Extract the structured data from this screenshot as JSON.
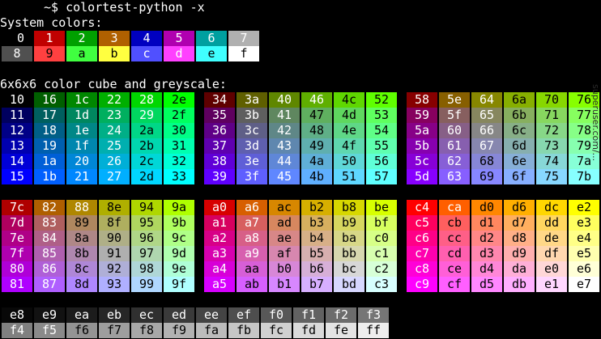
{
  "terminal": {
    "prompt_line": "~$ colortest-python -x",
    "system_header": "System colors:",
    "cube_header": "6x6x6 color cube and greyscale:",
    "watermark": "superuser.com/..."
  },
  "system_colors": {
    "row1": [
      {
        "label": " 0",
        "bg": "#000000",
        "fg": "#ffffff"
      },
      {
        "label": "1",
        "bg": "#c00000",
        "fg": "#ffffff"
      },
      {
        "label": "2",
        "bg": "#00a000",
        "fg": "#ffffff"
      },
      {
        "label": "3",
        "bg": "#b06000",
        "fg": "#ffffff"
      },
      {
        "label": "4",
        "bg": "#0000c0",
        "fg": "#ffffff"
      },
      {
        "label": "5",
        "bg": "#b000b0",
        "fg": "#ffffff"
      },
      {
        "label": "6",
        "bg": "#00a0a0",
        "fg": "#ffffff"
      },
      {
        "label": "7",
        "bg": "#b0b0b0",
        "fg": "#ffffff"
      }
    ],
    "row2": [
      {
        "label": "8",
        "bg": "#505050",
        "fg": "#ffffff"
      },
      {
        "label": "9",
        "bg": "#ff4040",
        "fg": "#000000"
      },
      {
        "label": "a",
        "bg": "#40ff40",
        "fg": "#000000"
      },
      {
        "label": "b",
        "bg": "#ffff40",
        "fg": "#000000"
      },
      {
        "label": "c",
        "bg": "#5050ff",
        "fg": "#ffffff"
      },
      {
        "label": "d",
        "bg": "#ff40ff",
        "fg": "#ffffff"
      },
      {
        "label": "e",
        "bg": "#40ffff",
        "fg": "#000000"
      },
      {
        "label": "f",
        "bg": "#ffffff",
        "fg": "#000000"
      }
    ]
  },
  "cube_blocks": [
    {
      "rows": [
        [
          "10",
          "16",
          "1c",
          "22",
          "28",
          "2e"
        ],
        [
          "11",
          "17",
          "1d",
          "23",
          "29",
          "2f"
        ],
        [
          "12",
          "18",
          "1e",
          "24",
          "2a",
          "30"
        ],
        [
          "13",
          "19",
          "1f",
          "25",
          "2b",
          "31"
        ],
        [
          "14",
          "1a",
          "20",
          "26",
          "2c",
          "32"
        ],
        [
          "15",
          "1b",
          "21",
          "27",
          "2d",
          "33"
        ]
      ]
    },
    {
      "rows": [
        [
          "34",
          "3a",
          "40",
          "46",
          "4c",
          "52"
        ],
        [
          "35",
          "3b",
          "41",
          "47",
          "4d",
          "53"
        ],
        [
          "36",
          "3c",
          "42",
          "48",
          "4e",
          "54"
        ],
        [
          "37",
          "3d",
          "43",
          "49",
          "4f",
          "55"
        ],
        [
          "38",
          "3e",
          "44",
          "4a",
          "50",
          "56"
        ],
        [
          "39",
          "3f",
          "45",
          "4b",
          "51",
          "57"
        ]
      ]
    },
    {
      "rows": [
        [
          "58",
          "5e",
          "64",
          "6a",
          "70",
          "76"
        ],
        [
          "59",
          "5f",
          "65",
          "6b",
          "71",
          "77"
        ],
        [
          "5a",
          "60",
          "66",
          "6c",
          "72",
          "78"
        ],
        [
          "5b",
          "61",
          "67",
          "6d",
          "73",
          "79"
        ],
        [
          "5c",
          "62",
          "68",
          "6e",
          "74",
          "7a"
        ],
        [
          "5d",
          "63",
          "69",
          "6f",
          "75",
          "7b"
        ]
      ]
    },
    {
      "rows": [
        [
          "7c",
          "82",
          "88",
          "8e",
          "94",
          "9a"
        ],
        [
          "7d",
          "83",
          "89",
          "8f",
          "95",
          "9b"
        ],
        [
          "7e",
          "84",
          "8a",
          "90",
          "96",
          "9c"
        ],
        [
          "7f",
          "85",
          "8b",
          "91",
          "97",
          "9d"
        ],
        [
          "80",
          "86",
          "8c",
          "92",
          "98",
          "9e"
        ],
        [
          "81",
          "87",
          "8d",
          "93",
          "99",
          "9f"
        ]
      ]
    },
    {
      "rows": [
        [
          "a0",
          "a6",
          "ac",
          "b2",
          "b8",
          "be"
        ],
        [
          "a1",
          "a7",
          "ad",
          "b3",
          "b9",
          "bf"
        ],
        [
          "a2",
          "a8",
          "ae",
          "b4",
          "ba",
          "c0"
        ],
        [
          "a3",
          "a9",
          "af",
          "b5",
          "bb",
          "c1"
        ],
        [
          "a4",
          "aa",
          "b0",
          "b6",
          "bc",
          "c2"
        ],
        [
          "a5",
          "ab",
          "b1",
          "b7",
          "bd",
          "c3"
        ]
      ]
    },
    {
      "rows": [
        [
          "c4",
          "ca",
          "d0",
          "d6",
          "dc",
          "e2"
        ],
        [
          "c5",
          "cb",
          "d1",
          "d7",
          "dd",
          "e3"
        ],
        [
          "c6",
          "cc",
          "d2",
          "d8",
          "de",
          "e4"
        ],
        [
          "c7",
          "cd",
          "d3",
          "d9",
          "df",
          "e5"
        ],
        [
          "c8",
          "ce",
          "d4",
          "da",
          "e0",
          "e6"
        ],
        [
          "c9",
          "cf",
          "d5",
          "db",
          "e1",
          "e7"
        ]
      ]
    }
  ],
  "greyscale": {
    "row1": [
      "e8",
      "e9",
      "ea",
      "eb",
      "ec",
      "ed",
      "ee",
      "ef",
      "f0",
      "f1",
      "f2",
      "f3"
    ],
    "row2": [
      "f4",
      "f5",
      "f6",
      "f7",
      "f8",
      "f9",
      "fa",
      "fb",
      "fc",
      "fd",
      "fe",
      "ff"
    ]
  }
}
